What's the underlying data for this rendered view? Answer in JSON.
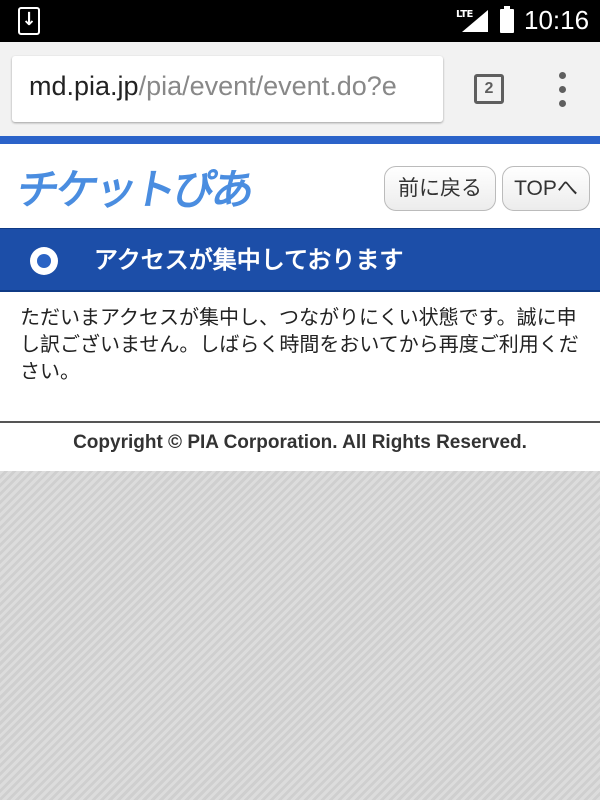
{
  "status_bar": {
    "network": "LTE",
    "time": "10:16",
    "icons": [
      "download-notification-icon",
      "signal-icon",
      "battery-icon"
    ]
  },
  "browser": {
    "url_host": "md.pia.jp",
    "url_path": "/pia/event/event.do?e",
    "tab_count": "2"
  },
  "site": {
    "logo_text": "チケットぴあ",
    "back_button": "前に戻る",
    "top_button": "TOPへ"
  },
  "notice": {
    "title": "アクセスが集中しております",
    "message": "ただいまアクセスが集中し、つながりにくい状態です。誠に申し訳ございません。しばらく時間をおいてから再度ご利用ください。"
  },
  "footer": {
    "copyright": "Copyright © PIA Corporation. All Rights Reserved."
  },
  "colors": {
    "brand_blue": "#1c4ea8",
    "logo_blue": "#4a8de0"
  }
}
